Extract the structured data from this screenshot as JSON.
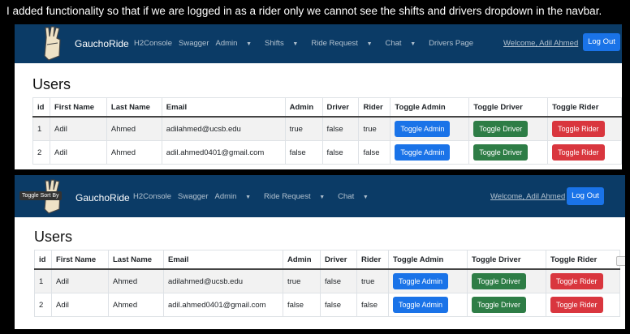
{
  "caption": "I added functionality so that if we are logged in as a rider only we cannot see the shifts and drivers dropdown in the navbar.",
  "colors": {
    "navbar": "#0b3b66",
    "primary": "#1a73e8",
    "success": "#2e7d46",
    "danger": "#d9363e"
  },
  "panel1": {
    "brand": "GauchoRide",
    "nav": [
      "H2Console",
      "Swagger",
      "Admin",
      "Shifts",
      "Ride Request",
      "Chat",
      "Drivers Page"
    ],
    "welcome": "Welcome, Adil Ahmed",
    "logout": "Log Out",
    "title": "Users",
    "headers": [
      "id",
      "First Name",
      "Last Name",
      "Email",
      "Admin",
      "Driver",
      "Rider",
      "Toggle Admin",
      "Toggle Driver",
      "Toggle Rider"
    ],
    "rows": [
      {
        "id": "1",
        "first": "Adil",
        "last": "Ahmed",
        "email": "adilahmed@ucsb.edu",
        "admin": "true",
        "driver": "false",
        "rider": "true",
        "ta": "Toggle Admin",
        "td": "Toggle Driver",
        "tr": "Toggle Rider"
      },
      {
        "id": "2",
        "first": "Adil",
        "last": "Ahmed",
        "email": "adil.ahmed0401@gmail.com",
        "admin": "false",
        "driver": "false",
        "rider": "false",
        "ta": "Toggle Admin",
        "td": "Toggle Driver",
        "tr": "Toggle Rider"
      }
    ]
  },
  "panel2": {
    "tooltip": "Toggle Sort By",
    "brand": "GauchoRide",
    "nav": [
      "H2Console",
      "Swagger",
      "Admin",
      "Ride Request",
      "Chat"
    ],
    "welcome": "Welcome, Adil Ahmed",
    "logout": "Log Out",
    "title": "Users",
    "headers": [
      "id",
      "First Name",
      "Last Name",
      "Email",
      "Admin",
      "Driver",
      "Rider",
      "Toggle Admin",
      "Toggle Driver",
      "Toggle Rider"
    ],
    "rows": [
      {
        "id": "1",
        "first": "Adil",
        "last": "Ahmed",
        "email": "adilahmed@ucsb.edu",
        "admin": "true",
        "driver": "false",
        "rider": "true",
        "ta": "Toggle Admin",
        "td": "Toggle Driver",
        "tr": "Toggle Rider"
      },
      {
        "id": "2",
        "first": "Adil",
        "last": "Ahmed",
        "email": "adil.ahmed0401@gmail.com",
        "admin": "false",
        "driver": "false",
        "rider": "false",
        "ta": "Toggle Admin",
        "td": "Toggle Driver",
        "tr": "Toggle Rider"
      }
    ]
  }
}
